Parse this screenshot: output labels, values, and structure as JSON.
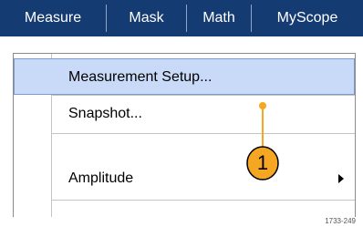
{
  "menubar": {
    "items": [
      "Measure",
      "Mask",
      "Math",
      "MyScope"
    ]
  },
  "dropdown": {
    "items": [
      {
        "label": "Measurement Setup...",
        "selected": true
      },
      {
        "label": "Snapshot...",
        "selected": false
      },
      {
        "label": "Amplitude",
        "selected": false,
        "has_submenu": true
      }
    ]
  },
  "callout": {
    "number": "1"
  },
  "figure_id": "1733-249",
  "colors": {
    "menubar_bg": "#153b73",
    "selected_bg": "#c9daf8",
    "callout_fill": "#f5a623"
  }
}
